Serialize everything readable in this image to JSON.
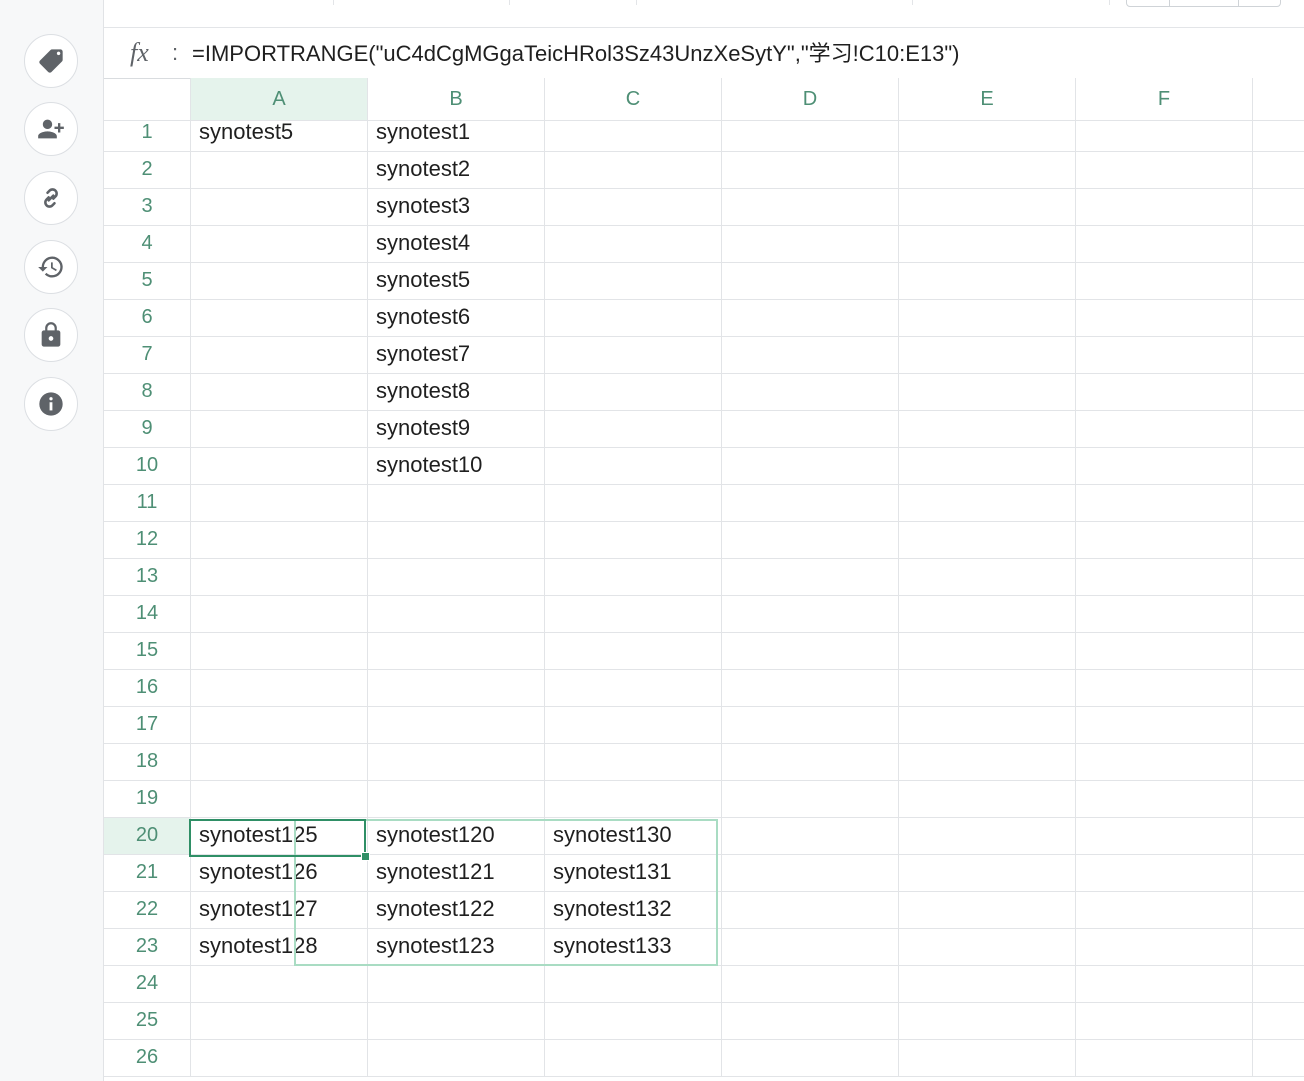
{
  "sidebar": {
    "buttons": [
      {
        "name": "tag-icon"
      },
      {
        "name": "add-user-icon"
      },
      {
        "name": "link-icon"
      },
      {
        "name": "history-icon"
      },
      {
        "name": "lock-icon"
      },
      {
        "name": "info-icon"
      }
    ]
  },
  "formula_bar": {
    "fx_label": "fx",
    "colon": ":",
    "formula": "=IMPORTRANGE(\"uC4dCgMGgaTeicHRol3Sz43UnzXeSytY\",\"学习!C10:E13\")"
  },
  "sheet": {
    "columns": [
      "A",
      "B",
      "C",
      "D",
      "E",
      "F"
    ],
    "active_column": "A",
    "active_row": "20",
    "rows": [
      {
        "n": "1",
        "cells": [
          "synotest5",
          "synotest1",
          "",
          "",
          "",
          ""
        ]
      },
      {
        "n": "2",
        "cells": [
          "",
          "synotest2",
          "",
          "",
          "",
          ""
        ]
      },
      {
        "n": "3",
        "cells": [
          "",
          "synotest3",
          "",
          "",
          "",
          ""
        ]
      },
      {
        "n": "4",
        "cells": [
          "",
          "synotest4",
          "",
          "",
          "",
          ""
        ]
      },
      {
        "n": "5",
        "cells": [
          "",
          "synotest5",
          "",
          "",
          "",
          ""
        ]
      },
      {
        "n": "6",
        "cells": [
          "",
          "synotest6",
          "",
          "",
          "",
          ""
        ]
      },
      {
        "n": "7",
        "cells": [
          "",
          "synotest7",
          "",
          "",
          "",
          ""
        ]
      },
      {
        "n": "8",
        "cells": [
          "",
          "synotest8",
          "",
          "",
          "",
          ""
        ]
      },
      {
        "n": "9",
        "cells": [
          "",
          "synotest9",
          "",
          "",
          "",
          ""
        ]
      },
      {
        "n": "10",
        "cells": [
          "",
          "synotest10",
          "",
          "",
          "",
          ""
        ]
      },
      {
        "n": "11",
        "cells": [
          "",
          "",
          "",
          "",
          "",
          ""
        ]
      },
      {
        "n": "12",
        "cells": [
          "",
          "",
          "",
          "",
          "",
          ""
        ]
      },
      {
        "n": "13",
        "cells": [
          "",
          "",
          "",
          "",
          "",
          ""
        ]
      },
      {
        "n": "14",
        "cells": [
          "",
          "",
          "",
          "",
          "",
          ""
        ]
      },
      {
        "n": "15",
        "cells": [
          "",
          "",
          "",
          "",
          "",
          ""
        ]
      },
      {
        "n": "16",
        "cells": [
          "",
          "",
          "",
          "",
          "",
          ""
        ]
      },
      {
        "n": "17",
        "cells": [
          "",
          "",
          "",
          "",
          "",
          ""
        ]
      },
      {
        "n": "18",
        "cells": [
          "",
          "",
          "",
          "",
          "",
          ""
        ]
      },
      {
        "n": "19",
        "cells": [
          "",
          "",
          "",
          "",
          "",
          ""
        ]
      },
      {
        "n": "20",
        "cells": [
          "synotest125",
          "synotest120",
          "synotest130",
          "",
          "",
          ""
        ]
      },
      {
        "n": "21",
        "cells": [
          "synotest126",
          "synotest121",
          "synotest131",
          "",
          "",
          ""
        ]
      },
      {
        "n": "22",
        "cells": [
          "synotest127",
          "synotest122",
          "synotest132",
          "",
          "",
          ""
        ]
      },
      {
        "n": "23",
        "cells": [
          "synotest128",
          "synotest123",
          "synotest133",
          "",
          "",
          ""
        ]
      },
      {
        "n": "24",
        "cells": [
          "",
          "",
          "",
          "",
          "",
          ""
        ]
      },
      {
        "n": "25",
        "cells": [
          "",
          "",
          "",
          "",
          "",
          ""
        ]
      },
      {
        "n": "26",
        "cells": [
          "",
          "",
          "",
          "",
          "",
          ""
        ]
      }
    ]
  },
  "colors": {
    "accent": "#2f8f66",
    "header_text": "#4e8f75",
    "selection_fill": "#e5f3ec",
    "range_border": "#a9dcc3"
  }
}
